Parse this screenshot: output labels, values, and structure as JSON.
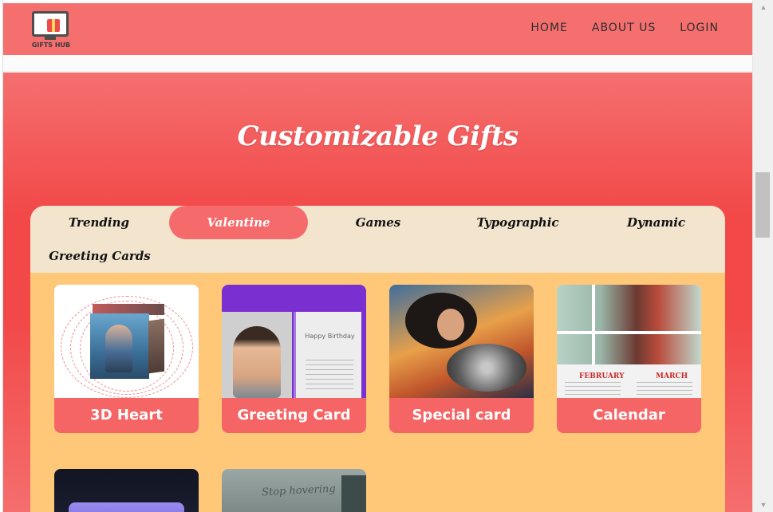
{
  "brand": {
    "logo_text": "GIFTS HUB"
  },
  "nav": {
    "links": [
      {
        "label": "HOME"
      },
      {
        "label": "ABOUT US"
      },
      {
        "label": "LOGIN"
      }
    ]
  },
  "hero": {
    "title": "Customizable Gifts"
  },
  "tabs": [
    {
      "label": "Trending"
    },
    {
      "label": "Valentine",
      "active": true
    },
    {
      "label": "Games"
    },
    {
      "label": "Typographic"
    },
    {
      "label": "Dynamic"
    },
    {
      "label": "Greeting Cards"
    }
  ],
  "cards": [
    {
      "label": "3D Heart"
    },
    {
      "label": "Greeting Card"
    },
    {
      "label": "Special card"
    },
    {
      "label": "Calendar"
    }
  ],
  "card_art": {
    "greeting_heading": "Happy Birthday",
    "calendar_months": [
      "FEBRUARY",
      "MARCH"
    ],
    "hover_text": "Stop hovering"
  },
  "colors": {
    "navbar": "#f56f6f",
    "hero": "#f24848",
    "tab_bar": "#f3e4cd",
    "panel": "#ffc879",
    "card_label": "#f56565"
  },
  "scrollbar": {
    "up_icon": "scroll-up-arrow-icon",
    "down_icon": "scroll-down-arrow-icon"
  }
}
